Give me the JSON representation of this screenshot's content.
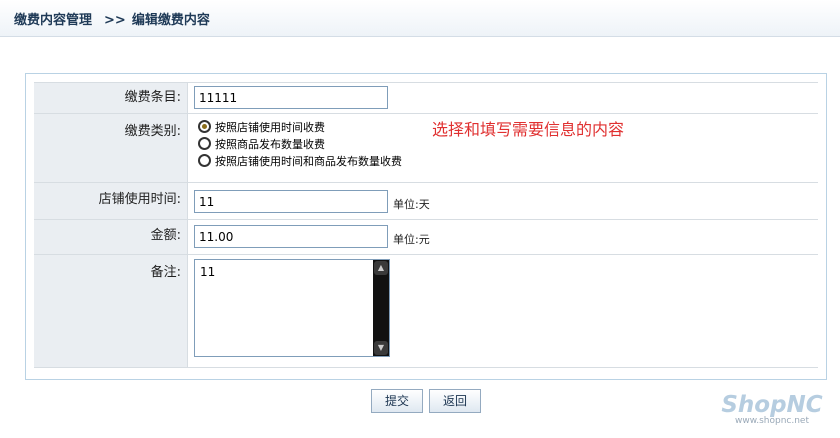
{
  "breadcrumb": {
    "section": "缴费内容管理",
    "separator": ">>",
    "current": "编辑缴费内容"
  },
  "form": {
    "item": {
      "label": "缴费条目:",
      "value": "11111"
    },
    "type": {
      "label": "缴费类别:",
      "options": [
        {
          "label": "按照店铺使用时间收费",
          "checked": true
        },
        {
          "label": "按照商品发布数量收费",
          "checked": false
        },
        {
          "label": "按照店铺使用时间和商品发布数量收费",
          "checked": false
        }
      ],
      "hint": "选择和填写需要信息的内容"
    },
    "shop_time": {
      "label": "店铺使用时间:",
      "value": "11",
      "unit": "单位:天"
    },
    "amount": {
      "label": "金额:",
      "value": "11.00",
      "unit": "单位:元"
    },
    "note": {
      "label": "备注:",
      "value": "11"
    }
  },
  "buttons": {
    "submit": "提交",
    "back": "返回"
  },
  "brand": {
    "logo": "ShopNC",
    "url": "www.shopnc.net"
  },
  "icons": {
    "scroll_up": "scroll-up-arrow-icon",
    "scroll_down": "scroll-down-arrow-icon"
  }
}
